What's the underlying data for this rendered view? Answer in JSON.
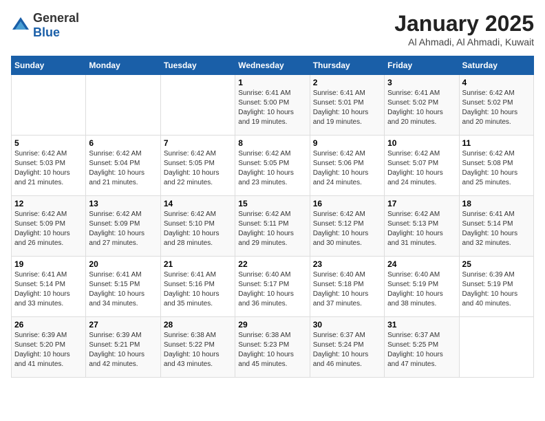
{
  "logo": {
    "text_general": "General",
    "text_blue": "Blue"
  },
  "calendar": {
    "title": "January 2025",
    "subtitle": "Al Ahmadi, Al Ahmadi, Kuwait"
  },
  "headers": [
    "Sunday",
    "Monday",
    "Tuesday",
    "Wednesday",
    "Thursday",
    "Friday",
    "Saturday"
  ],
  "weeks": [
    [
      {
        "day": "",
        "info": ""
      },
      {
        "day": "",
        "info": ""
      },
      {
        "day": "",
        "info": ""
      },
      {
        "day": "1",
        "info": "Sunrise: 6:41 AM\nSunset: 5:00 PM\nDaylight: 10 hours\nand 19 minutes."
      },
      {
        "day": "2",
        "info": "Sunrise: 6:41 AM\nSunset: 5:01 PM\nDaylight: 10 hours\nand 19 minutes."
      },
      {
        "day": "3",
        "info": "Sunrise: 6:41 AM\nSunset: 5:02 PM\nDaylight: 10 hours\nand 20 minutes."
      },
      {
        "day": "4",
        "info": "Sunrise: 6:42 AM\nSunset: 5:02 PM\nDaylight: 10 hours\nand 20 minutes."
      }
    ],
    [
      {
        "day": "5",
        "info": "Sunrise: 6:42 AM\nSunset: 5:03 PM\nDaylight: 10 hours\nand 21 minutes."
      },
      {
        "day": "6",
        "info": "Sunrise: 6:42 AM\nSunset: 5:04 PM\nDaylight: 10 hours\nand 21 minutes."
      },
      {
        "day": "7",
        "info": "Sunrise: 6:42 AM\nSunset: 5:05 PM\nDaylight: 10 hours\nand 22 minutes."
      },
      {
        "day": "8",
        "info": "Sunrise: 6:42 AM\nSunset: 5:05 PM\nDaylight: 10 hours\nand 23 minutes."
      },
      {
        "day": "9",
        "info": "Sunrise: 6:42 AM\nSunset: 5:06 PM\nDaylight: 10 hours\nand 24 minutes."
      },
      {
        "day": "10",
        "info": "Sunrise: 6:42 AM\nSunset: 5:07 PM\nDaylight: 10 hours\nand 24 minutes."
      },
      {
        "day": "11",
        "info": "Sunrise: 6:42 AM\nSunset: 5:08 PM\nDaylight: 10 hours\nand 25 minutes."
      }
    ],
    [
      {
        "day": "12",
        "info": "Sunrise: 6:42 AM\nSunset: 5:09 PM\nDaylight: 10 hours\nand 26 minutes."
      },
      {
        "day": "13",
        "info": "Sunrise: 6:42 AM\nSunset: 5:09 PM\nDaylight: 10 hours\nand 27 minutes."
      },
      {
        "day": "14",
        "info": "Sunrise: 6:42 AM\nSunset: 5:10 PM\nDaylight: 10 hours\nand 28 minutes."
      },
      {
        "day": "15",
        "info": "Sunrise: 6:42 AM\nSunset: 5:11 PM\nDaylight: 10 hours\nand 29 minutes."
      },
      {
        "day": "16",
        "info": "Sunrise: 6:42 AM\nSunset: 5:12 PM\nDaylight: 10 hours\nand 30 minutes."
      },
      {
        "day": "17",
        "info": "Sunrise: 6:42 AM\nSunset: 5:13 PM\nDaylight: 10 hours\nand 31 minutes."
      },
      {
        "day": "18",
        "info": "Sunrise: 6:41 AM\nSunset: 5:14 PM\nDaylight: 10 hours\nand 32 minutes."
      }
    ],
    [
      {
        "day": "19",
        "info": "Sunrise: 6:41 AM\nSunset: 5:14 PM\nDaylight: 10 hours\nand 33 minutes."
      },
      {
        "day": "20",
        "info": "Sunrise: 6:41 AM\nSunset: 5:15 PM\nDaylight: 10 hours\nand 34 minutes."
      },
      {
        "day": "21",
        "info": "Sunrise: 6:41 AM\nSunset: 5:16 PM\nDaylight: 10 hours\nand 35 minutes."
      },
      {
        "day": "22",
        "info": "Sunrise: 6:40 AM\nSunset: 5:17 PM\nDaylight: 10 hours\nand 36 minutes."
      },
      {
        "day": "23",
        "info": "Sunrise: 6:40 AM\nSunset: 5:18 PM\nDaylight: 10 hours\nand 37 minutes."
      },
      {
        "day": "24",
        "info": "Sunrise: 6:40 AM\nSunset: 5:19 PM\nDaylight: 10 hours\nand 38 minutes."
      },
      {
        "day": "25",
        "info": "Sunrise: 6:39 AM\nSunset: 5:19 PM\nDaylight: 10 hours\nand 40 minutes."
      }
    ],
    [
      {
        "day": "26",
        "info": "Sunrise: 6:39 AM\nSunset: 5:20 PM\nDaylight: 10 hours\nand 41 minutes."
      },
      {
        "day": "27",
        "info": "Sunrise: 6:39 AM\nSunset: 5:21 PM\nDaylight: 10 hours\nand 42 minutes."
      },
      {
        "day": "28",
        "info": "Sunrise: 6:38 AM\nSunset: 5:22 PM\nDaylight: 10 hours\nand 43 minutes."
      },
      {
        "day": "29",
        "info": "Sunrise: 6:38 AM\nSunset: 5:23 PM\nDaylight: 10 hours\nand 45 minutes."
      },
      {
        "day": "30",
        "info": "Sunrise: 6:37 AM\nSunset: 5:24 PM\nDaylight: 10 hours\nand 46 minutes."
      },
      {
        "day": "31",
        "info": "Sunrise: 6:37 AM\nSunset: 5:25 PM\nDaylight: 10 hours\nand 47 minutes."
      },
      {
        "day": "",
        "info": ""
      }
    ]
  ]
}
